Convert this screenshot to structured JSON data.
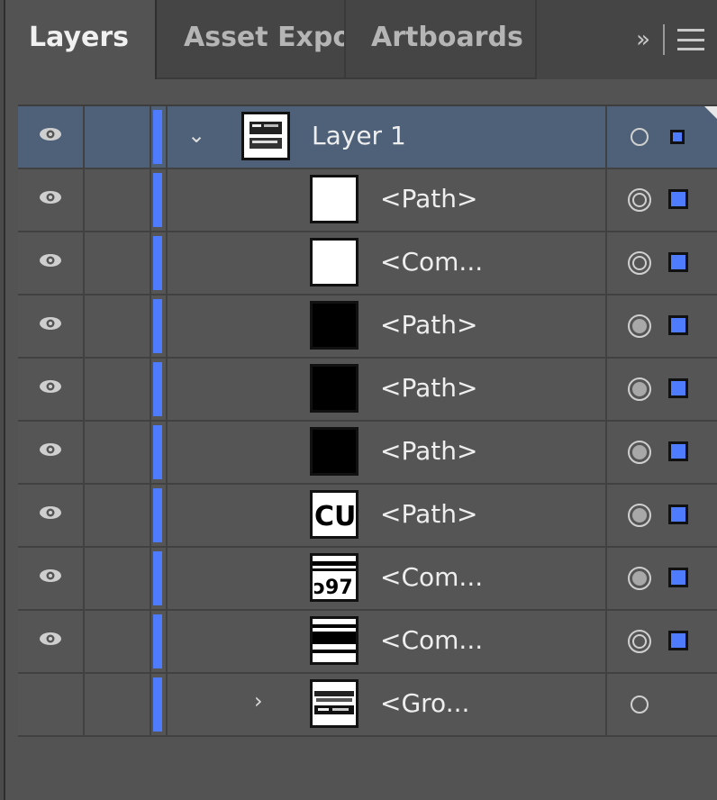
{
  "tabs": [
    {
      "label": "Layers",
      "active": true
    },
    {
      "label": "Asset Expo",
      "active": false
    },
    {
      "label": "Artboards",
      "active": false
    }
  ],
  "tab_overflow": {
    "chevrons": "»"
  },
  "layers": [
    {
      "name": "Layer 1",
      "indent": 0,
      "expanded": true,
      "visible": true,
      "selected": true,
      "thumb": "layer",
      "target": "empty",
      "has_select_square": true
    },
    {
      "name": "<Path>",
      "indent": 1,
      "visible": true,
      "thumb": "white",
      "target": "ring"
    },
    {
      "name": "<Com...",
      "indent": 1,
      "visible": true,
      "thumb": "white",
      "target": "ring"
    },
    {
      "name": "<Path>",
      "indent": 1,
      "visible": true,
      "thumb": "black",
      "target": "filled"
    },
    {
      "name": "<Path>",
      "indent": 1,
      "visible": true,
      "thumb": "black",
      "target": "filled"
    },
    {
      "name": "<Path>",
      "indent": 1,
      "visible": true,
      "thumb": "black",
      "target": "filled"
    },
    {
      "name": "<Path>",
      "indent": 1,
      "visible": true,
      "thumb": "glyph-cu",
      "target": "filled"
    },
    {
      "name": "<Com...",
      "indent": 1,
      "visible": true,
      "thumb": "glyph-text",
      "target": "filled"
    },
    {
      "name": "<Com...",
      "indent": 1,
      "visible": true,
      "thumb": "bars",
      "target": "ring"
    },
    {
      "name": "<Gro...",
      "indent": 1,
      "expanded": false,
      "visible": false,
      "thumb": "group",
      "target": "empty"
    }
  ],
  "colors": {
    "layer_color": "#4f7bff",
    "selected_row": "#4e6178",
    "panel": "#535353"
  }
}
